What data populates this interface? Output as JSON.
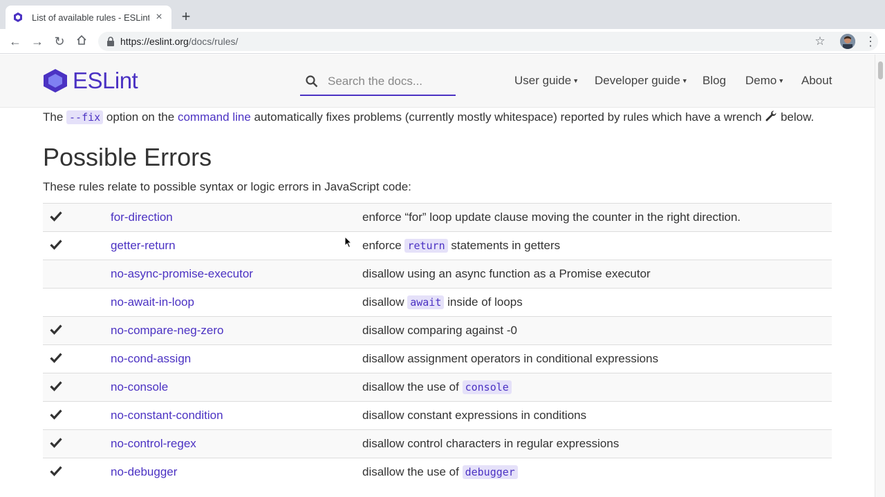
{
  "browser": {
    "tab_title": "List of available rules - ESLint - ",
    "new_tab": "+",
    "url_host": "https://eslint.org",
    "url_path": "/docs/rules/"
  },
  "header": {
    "logo_text": "ESLint",
    "search_placeholder": "Search the docs...",
    "nav": [
      "User guide",
      "Developer guide",
      "Blog",
      "Demo",
      "About"
    ]
  },
  "intro": {
    "prefix": "The ",
    "fix_code": "--fix",
    "middle": " option on the ",
    "link": "command line",
    "suffix": " automatically fixes problems (currently mostly whitespace) reported by rules which have a wrench ",
    "end": " below."
  },
  "section": {
    "title": "Possible Errors",
    "description": "These rules relate to possible syntax or logic errors in JavaScript code:"
  },
  "rules": [
    {
      "recommended": true,
      "name": "for-direction",
      "desc_before": "enforce “for” loop update clause moving the counter in the right direction.",
      "code": "",
      "desc_after": ""
    },
    {
      "recommended": true,
      "name": "getter-return",
      "desc_before": "enforce ",
      "code": "return",
      "desc_after": " statements in getters"
    },
    {
      "recommended": false,
      "name": "no-async-promise-executor",
      "desc_before": "disallow using an async function as a Promise executor",
      "code": "",
      "desc_after": ""
    },
    {
      "recommended": false,
      "name": "no-await-in-loop",
      "desc_before": "disallow ",
      "code": "await",
      "desc_after": " inside of loops"
    },
    {
      "recommended": true,
      "name": "no-compare-neg-zero",
      "desc_before": "disallow comparing against -0",
      "code": "",
      "desc_after": ""
    },
    {
      "recommended": true,
      "name": "no-cond-assign",
      "desc_before": "disallow assignment operators in conditional expressions",
      "code": "",
      "desc_after": ""
    },
    {
      "recommended": true,
      "name": "no-console",
      "desc_before": "disallow the use of ",
      "code": "console",
      "desc_after": ""
    },
    {
      "recommended": true,
      "name": "no-constant-condition",
      "desc_before": "disallow constant expressions in conditions",
      "code": "",
      "desc_after": ""
    },
    {
      "recommended": true,
      "name": "no-control-regex",
      "desc_before": "disallow control characters in regular expressions",
      "code": "",
      "desc_after": ""
    },
    {
      "recommended": true,
      "name": "no-debugger",
      "desc_before": "disallow the use of ",
      "code": "debugger",
      "desc_after": ""
    }
  ],
  "colors": {
    "brand": "#4b32c3",
    "code_bg": "#e5e1f9"
  }
}
